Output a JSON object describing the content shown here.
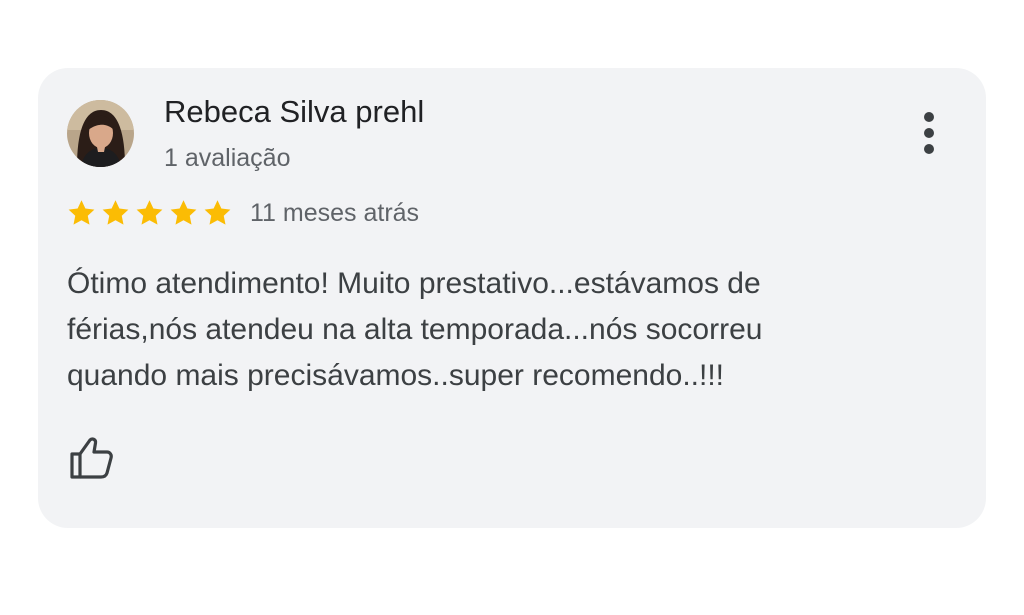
{
  "review": {
    "author_name": "Rebeca Silva prehl",
    "review_count": "1 avaliação",
    "rating": 5,
    "max_rating": 5,
    "time_ago": "11 meses atrás",
    "text": "Ótimo atendimento! Muito prestativo...estávamos de\nférias,nós atendeu na alta temporada...nós socorreu\nquando mais precisávamos..super recomendo..!!!"
  },
  "icons": {
    "avatar": "profile-photo",
    "menu": "more-vert-icon",
    "star": "star-icon",
    "like": "thumbs-up-icon"
  },
  "colors": {
    "card_background": "#f2f3f5",
    "star": "#fbbc04",
    "name_text": "#202124",
    "secondary_text": "#5f6368",
    "body_text": "#3c4043"
  }
}
